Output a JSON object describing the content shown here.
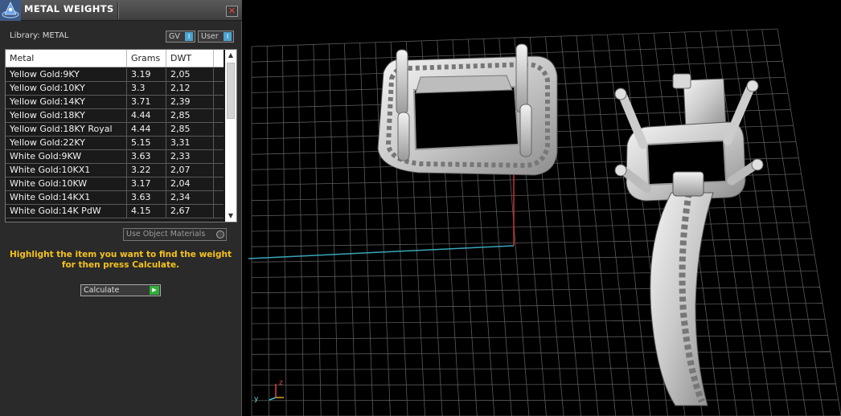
{
  "panel": {
    "title": "METAL WEIGHTS",
    "close_glyph": "✕",
    "library_label": "Library: METAL",
    "library_buttons": [
      {
        "label": "GV",
        "indicator": "I"
      },
      {
        "label": "User",
        "indicator": "I"
      }
    ],
    "columns": [
      "Metal",
      "Grams",
      "DWT"
    ],
    "rows": [
      {
        "metal": "Yellow Gold:9KY",
        "grams": "3.19",
        "dwt": "2,05"
      },
      {
        "metal": "Yellow Gold:10KY",
        "grams": "3.3",
        "dwt": "2,12"
      },
      {
        "metal": "Yellow Gold:14KY",
        "grams": "3.71",
        "dwt": "2,39"
      },
      {
        "metal": "Yellow Gold:18KY",
        "grams": "4.44",
        "dwt": "2,85"
      },
      {
        "metal": "Yellow Gold:18KY Royal",
        "grams": "4.44",
        "dwt": "2,85"
      },
      {
        "metal": "Yellow Gold:22KY",
        "grams": "5.15",
        "dwt": "3,31"
      },
      {
        "metal": "White Gold:9KW",
        "grams": "3.63",
        "dwt": "2,33"
      },
      {
        "metal": "White Gold:10KX1",
        "grams": "3.22",
        "dwt": "2,07"
      },
      {
        "metal": "White Gold:10KW",
        "grams": "3.17",
        "dwt": "2,04"
      },
      {
        "metal": "White Gold:14KX1",
        "grams": "3.63",
        "dwt": "2,34"
      },
      {
        "metal": "White Gold:14K PdW",
        "grams": "4.15",
        "dwt": "2,67"
      }
    ],
    "use_object_materials_label": "Use Object Materials",
    "instructions": "Highlight the item you want to find the weight for then press Calculate.",
    "calculate_label": "Calculate",
    "calculate_icon": "play-icon"
  },
  "viewport": {
    "axis_labels": {
      "z": "z",
      "y": "y"
    },
    "colors": {
      "grid": "#5a5a5a",
      "axis_x": "#3aa6b8",
      "axis_z": "#c8302a",
      "metal": "#d7d7d7"
    }
  }
}
